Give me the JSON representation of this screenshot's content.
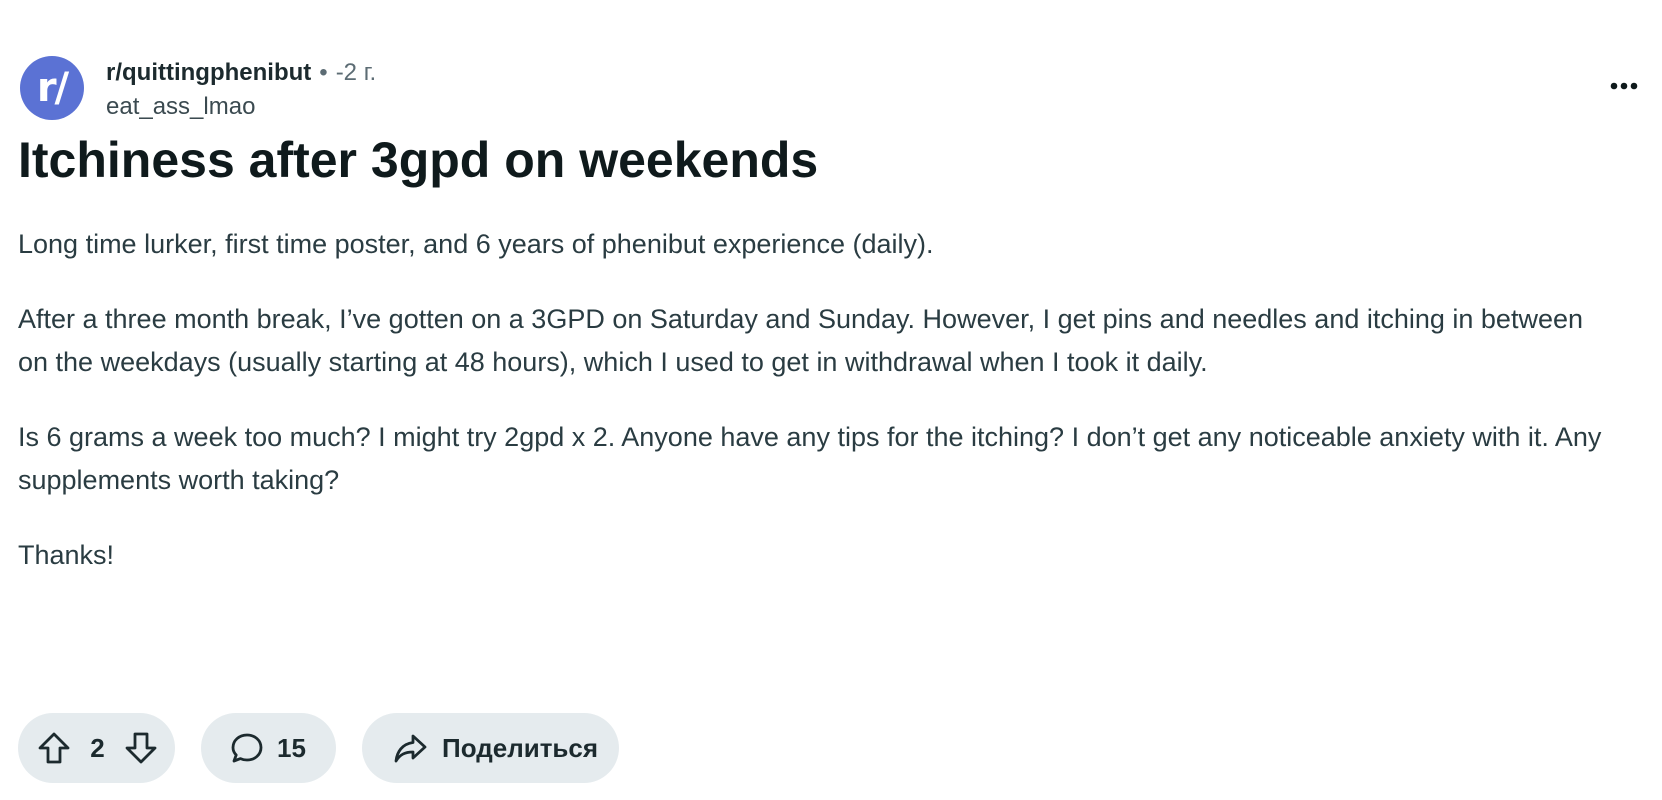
{
  "post": {
    "subreddit": "r/quittingphenibut",
    "separator": "•",
    "age": "-2 г.",
    "author": "eat_ass_lmao",
    "avatar_text": "r/",
    "title": "Itchiness after 3gpd on weekends",
    "body": [
      "Long time lurker, first time poster, and 6 years of phenibut experience (daily).",
      "After a three month break, I’ve gotten on a 3GPD on Saturday and Sunday. However, I get pins and needles and itching in between on the weekdays (usually starting at 48 hours), which I used to get in withdrawal when I took it daily.",
      "Is 6 grams a week too much? I might try 2gpd x 2. Anyone have any tips for the itching? I don’t get any noticeable anxiety with it. Any supplements worth taking?",
      "Thanks!"
    ]
  },
  "actions": {
    "vote_count": "2",
    "comment_count": "15",
    "share_label": "Поделиться"
  },
  "icons": {
    "upvote": "arrow-up-icon",
    "downvote": "arrow-down-icon",
    "comment": "speech-bubble-icon",
    "share": "share-arrow-icon",
    "overflow": "more-horizontal-icon"
  },
  "colors": {
    "avatar_bg": "#5b72d4",
    "pill_bg": "#e5ebee",
    "text_primary": "#0f1a1c",
    "text_body": "#2a3c42",
    "text_muted": "#5c6c74"
  }
}
